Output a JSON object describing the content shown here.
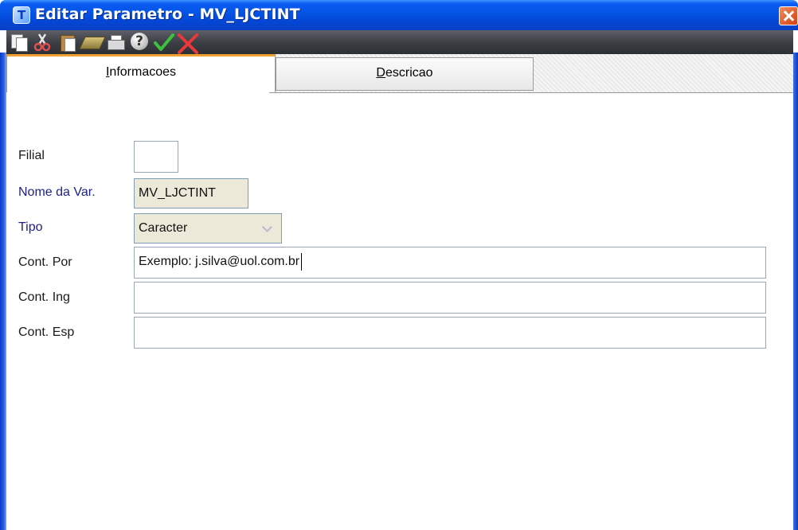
{
  "window": {
    "title": "Editar Parametro - MV_LJCTINT"
  },
  "toolbar": {
    "buttons": [
      {
        "icon": "copy-icon"
      },
      {
        "icon": "cut-icon"
      },
      {
        "icon": "paste-icon"
      },
      {
        "icon": "calculator-icon"
      },
      {
        "icon": "print-icon"
      },
      {
        "icon": "help-icon"
      },
      {
        "icon": "confirm-check-icon"
      },
      {
        "icon": "cancel-x-icon"
      }
    ]
  },
  "tabs": [
    {
      "label": "Informacoes",
      "active": true
    },
    {
      "label": "Descricao",
      "active": false
    }
  ],
  "form": {
    "filial": {
      "label": "Filial",
      "value": ""
    },
    "nome_da_var": {
      "label": "Nome da Var.",
      "value": "MV_LJCTINT"
    },
    "tipo": {
      "label": "Tipo",
      "value": "Caracter"
    },
    "cont_por": {
      "label": "Cont. Por",
      "value": "Exemplo: j.silva@uol.com.br"
    },
    "cont_ing": {
      "label": "Cont. Ing",
      "value": ""
    },
    "cont_esp": {
      "label": "Cont. Esp",
      "value": ""
    }
  },
  "colors": {
    "titlebar": "#0555e6",
    "toolbar": "#3a3d42",
    "active_tab_accent": "#f0a030",
    "required_label": "#1c1f8c",
    "readonly_field": "#ece9d8",
    "confirm": "#3fbf3f",
    "cancel": "#e8383a"
  }
}
